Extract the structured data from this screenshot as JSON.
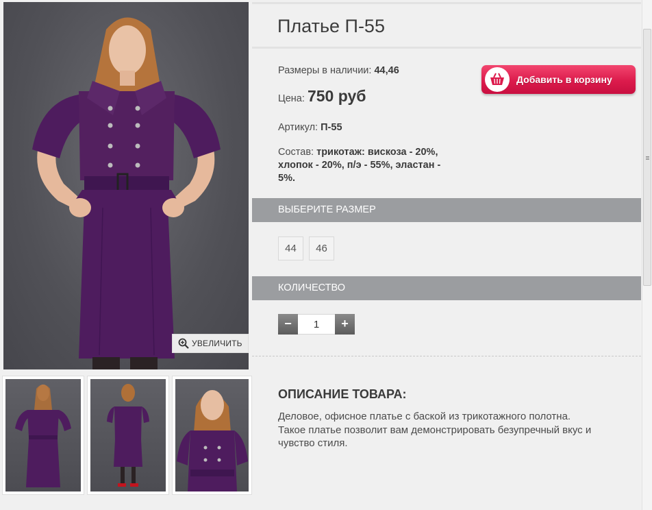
{
  "product": {
    "title": "Платье П-55",
    "sizes_label": "Размеры в наличии:",
    "sizes_value": "44,46",
    "price_label": "Цена:",
    "price_value": "750 руб",
    "sku_label": "Артикул:",
    "sku_value": "П-55",
    "composition_label": "Состав:",
    "composition_line1": "трикотаж: вискоза - 20%,",
    "composition_line2": "хлопок - 20%, п/э - 55%, эластан -",
    "composition_line3": "5%."
  },
  "cart_button": {
    "label": "Добавить в корзину",
    "icon": "shopping-basket-icon"
  },
  "gallery": {
    "zoom_label": "УВЕЛИЧИТЬ",
    "zoom_icon": "magnifier-plus-icon"
  },
  "size_section": {
    "header": "ВЫБЕРИТЕ РАЗМЕР",
    "options": [
      "44",
      "46"
    ]
  },
  "quantity_section": {
    "header": "КОЛИЧЕСТВО",
    "minus": "−",
    "plus": "+",
    "value": "1"
  },
  "description": {
    "title": "ОПИСАНИЕ ТОВАРА:",
    "text_line1": "Деловое, офисное платье с баской из трикотажного полотна.",
    "text_line2": "Такое платье позволит вам демонстрировать безупречный вкус и",
    "text_line3": "чувство стиля."
  },
  "colors": {
    "dress": "#4e1c5e",
    "cart_button": "#dc1b4c",
    "section_bar": "#9b9da0"
  }
}
